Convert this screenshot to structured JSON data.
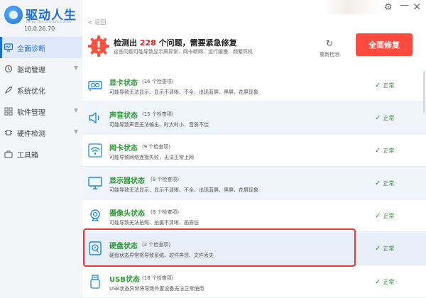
{
  "app": {
    "title": "驱动人生",
    "subtitle": "Drive The Life Since 2007",
    "version": "10.0.26.70"
  },
  "sidebar": {
    "items": [
      {
        "label": "全面诊断",
        "icon": "monitor-icon",
        "active": true
      },
      {
        "label": "驱动管理",
        "icon": "driver-icon",
        "expandable": true
      },
      {
        "label": "系统优化",
        "icon": "rocket-icon"
      },
      {
        "label": "软件管理",
        "icon": "apps-icon",
        "expandable": true
      },
      {
        "label": "硬件检测",
        "icon": "chip-icon",
        "expandable": true
      },
      {
        "label": "工具箱",
        "icon": "toolbox-icon"
      }
    ]
  },
  "topbar": {
    "back_label": "< 返回"
  },
  "summary": {
    "prefix": "检测出",
    "count": "228",
    "suffix": "个问题，需要紧急修复",
    "detail": "这些问题可能导致显示屏异常、网卡断网、运行缓慢、频繁死机",
    "rescan_label": "重新检测",
    "fix_label": "全面修复"
  },
  "rows": [
    {
      "title": "显卡状态",
      "count": "(16 个检查项)",
      "desc": "可能导致无法显示、显示不清晰、不全、出现蓝屏、黑屏、花屏现象",
      "status": "正常",
      "icon": "gpu-icon"
    },
    {
      "title": "声音状态",
      "count": "(15 个检查项)",
      "desc": "可能导致声音无法输出、时大时小、音质不佳",
      "status": "正常",
      "icon": "speaker-icon"
    },
    {
      "title": "网卡状态",
      "count": "(9 个检查项)",
      "desc": "可能导致网络连接失败，无法正常上网",
      "status": "正常",
      "icon": "wifi-icon"
    },
    {
      "title": "显示器状态",
      "count": "(8 个检查项)",
      "desc": "可能导致无法显示、显示不清晰、不全、出现蓝屏、黑屏、花屏现象",
      "status": "正常",
      "icon": "display-icon"
    },
    {
      "title": "摄像头状态",
      "count": "(8 个检查项)",
      "desc": "可能导致无法拍照、拍摄不清晰、画质低",
      "status": "正常",
      "icon": "webcam-icon"
    },
    {
      "title": "硬盘状态",
      "count": "(2 个检查项)",
      "desc": "硬盘状态异常将导致系统、软件奔溃、文件丢失",
      "status": "正常",
      "icon": "disk-icon"
    },
    {
      "title": "USB状态",
      "count": "(18 个检查项)",
      "desc": "USB状态异常将导致外置设备无法正常使用",
      "status": "正常",
      "icon": "usb-icon"
    }
  ],
  "colors": {
    "brand": "#1d6fd8",
    "danger": "#ff4a3d",
    "ok": "#2e9a36",
    "highlight": "#e53935"
  }
}
